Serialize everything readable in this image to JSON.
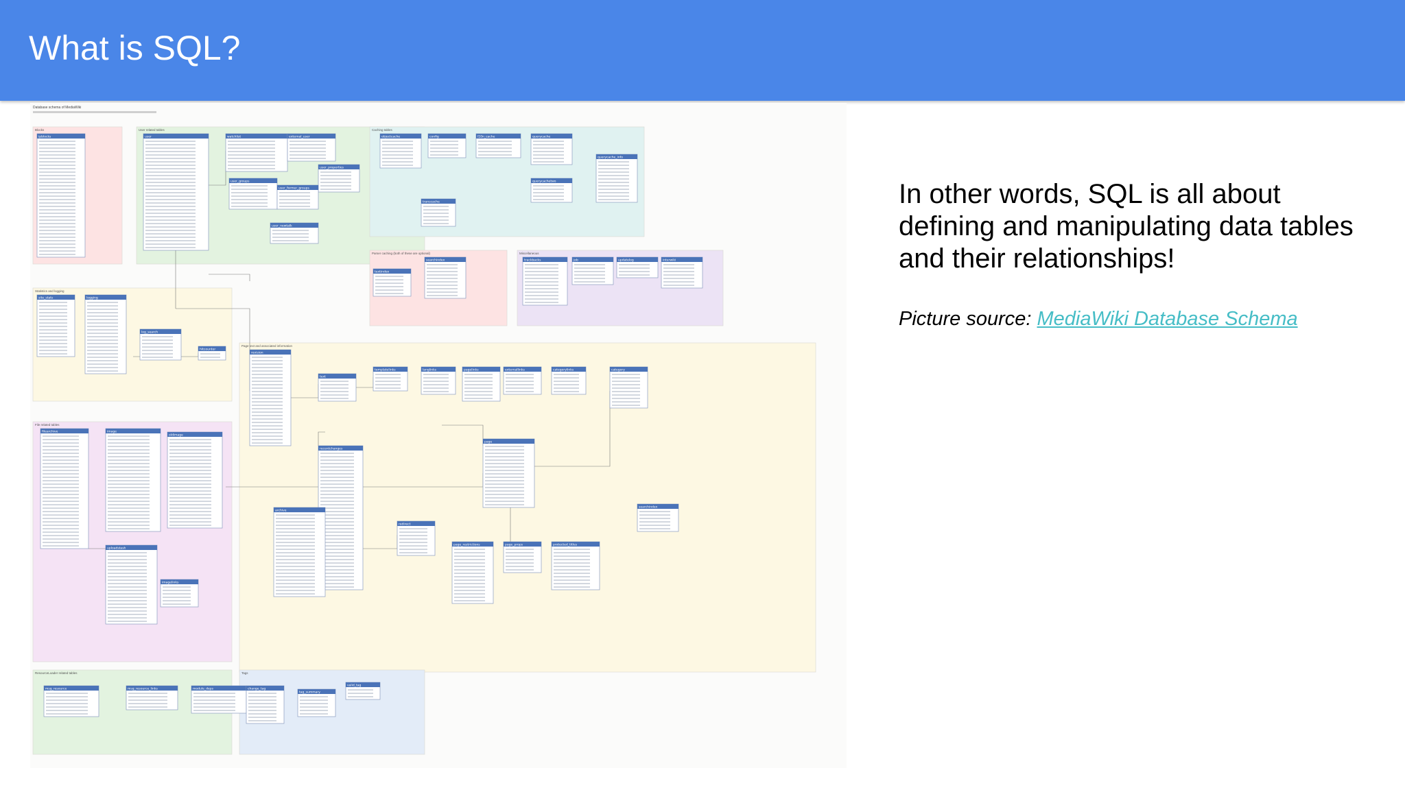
{
  "slide": {
    "title": "What is SQL?",
    "body_text": "In other words, SQL is all about defining and manipulating data tables and their relationships!",
    "source_label": "Picture source:",
    "source_link": "MediaWiki Database Schema"
  },
  "schema_image": {
    "header_text": "Database schema of MediaWiki",
    "groups": [
      {
        "label": "Blocks",
        "color": "#fde3e3",
        "tables": [
          "ipblocks"
        ]
      },
      {
        "label": "User related tables",
        "color": "#e3f3e0",
        "tables": [
          "user",
          "watchlist",
          "external_user",
          "user_properties",
          "user_groups",
          "user_former_groups",
          "user_newtalk"
        ]
      },
      {
        "label": "Caching tables",
        "color": "#e0f2f1",
        "tables": [
          "objectcache",
          "config",
          "l10n_cache",
          "querycache",
          "querycachetwo",
          "querycache_info",
          "transcache"
        ]
      },
      {
        "label": "Parser caching (both of these are optional)",
        "color": "#fde3e3",
        "tables": [
          "textindex",
          "searchindex"
        ]
      },
      {
        "label": "Miscellaneous",
        "color": "#ece3f5",
        "tables": [
          "trackbacks",
          "job",
          "updatelog",
          "interwiki"
        ]
      },
      {
        "label": "Statistics and logging",
        "color": "#fdf8e3",
        "tables": [
          "site_stats",
          "logging",
          "log_search",
          "hitcounter"
        ]
      },
      {
        "label": "Page text and associated information",
        "color": "#fdf8e3",
        "tables": [
          "revision",
          "text",
          "templatelinks",
          "langlinks",
          "pagelinks",
          "externallinks",
          "categorylinks",
          "category",
          "page",
          "recentchanges",
          "archive",
          "redirect",
          "page_restrictions",
          "page_props",
          "protected_titles",
          "searchindex"
        ]
      },
      {
        "label": "File related tables",
        "color": "#f5e3f5",
        "tables": [
          "filearchive",
          "image",
          "oldimage",
          "uploadstash",
          "imagelinks"
        ]
      },
      {
        "label": "ResourceLoader related tables",
        "color": "#e3f3e0",
        "tables": [
          "msg_resource",
          "msg_resource_links",
          "module_deps"
        ]
      },
      {
        "label": "Tags",
        "color": "#e3ecf8",
        "tables": [
          "change_tag",
          "tag_summary",
          "valid_tag"
        ]
      }
    ]
  },
  "colors": {
    "header_bg": "#4a86e8",
    "title_text": "#ffffff",
    "link": "#46bdc6",
    "table_header": "#4a73b8"
  },
  "icons": []
}
